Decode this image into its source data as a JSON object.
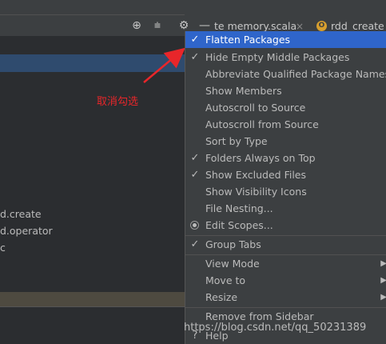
{
  "toolbar": {
    "icons": [
      "crosshair-icon",
      "collapse-all-icon",
      "gear-icon",
      "hide-icon"
    ]
  },
  "tabs": [
    {
      "label": "te memory.scala",
      "close": "×"
    },
    {
      "label": "rdd_create f",
      "badge": "O"
    }
  ],
  "tree": {
    "items": [
      "d.create",
      "d.operator",
      "c"
    ]
  },
  "annotation": {
    "text": "取消勾选",
    "color": "#e8262a"
  },
  "menu": {
    "items": [
      {
        "label": "Flatten Packages",
        "check": "✓",
        "highlighted": true
      },
      {
        "label": "Hide Empty Middle Packages",
        "check": "✓"
      },
      {
        "label": "Abbreviate Qualified Package Names",
        "check": ""
      },
      {
        "label": "Show Members",
        "check": ""
      },
      {
        "label": "Autoscroll to Source",
        "check": ""
      },
      {
        "label": "Autoscroll from Source",
        "check": ""
      },
      {
        "label": "Sort by Type",
        "check": ""
      },
      {
        "label": "Folders Always on Top",
        "check": "✓"
      },
      {
        "label": "Show Excluded Files",
        "check": "✓"
      },
      {
        "label": "Show Visibility Icons",
        "check": ""
      },
      {
        "label": "File Nesting...",
        "check": ""
      },
      {
        "label": "Edit Scopes...",
        "radio": true
      },
      {
        "label": "Group Tabs",
        "check": "✓"
      },
      {
        "label": "View Mode",
        "submenu": "▶"
      },
      {
        "label": "Move to",
        "submenu": "▶"
      },
      {
        "label": "Resize",
        "submenu": "▶"
      },
      {
        "label": "Remove from Sidebar",
        "check": ""
      },
      {
        "label": "Help",
        "check": "?"
      }
    ]
  },
  "watermark": "https://blog.csdn.net/qq_50231389",
  "colors": {
    "highlight": "#2f65ca",
    "panel": "#3c3f41",
    "background": "#2b2d30"
  }
}
